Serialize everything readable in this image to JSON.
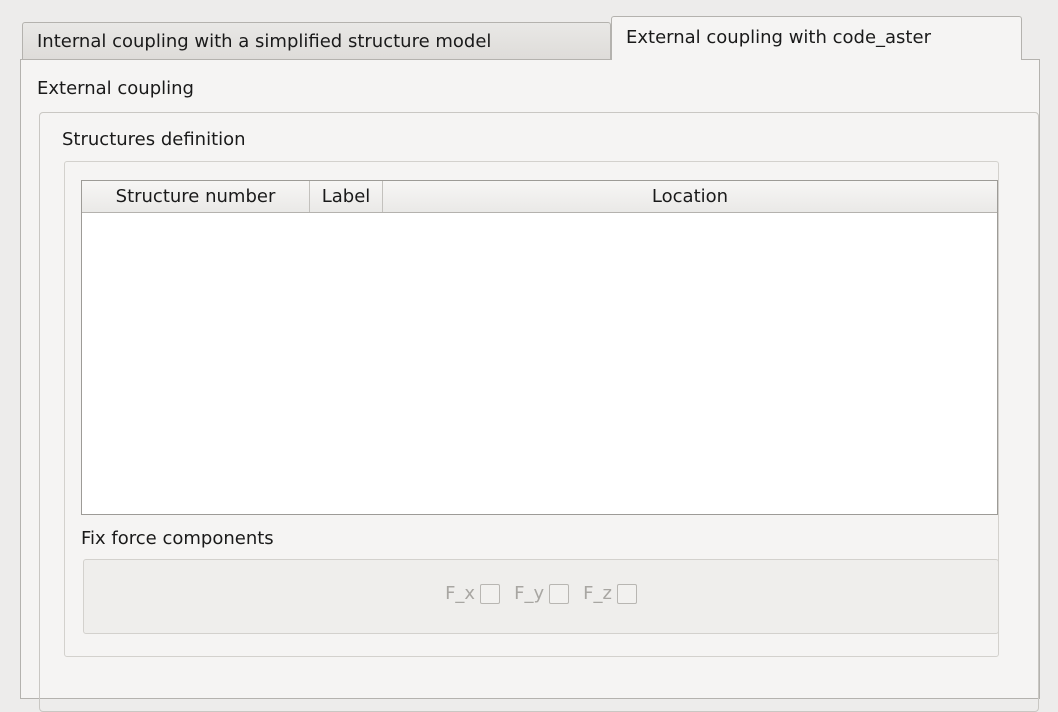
{
  "tabs": [
    {
      "label": "Internal coupling with a simplified structure model",
      "active": false
    },
    {
      "label": "External coupling with code_aster",
      "active": true
    }
  ],
  "pane": {
    "title": "External coupling",
    "structures": {
      "title": "Structures definition",
      "columns": [
        "Structure number",
        "Label",
        "Location"
      ],
      "rows": []
    },
    "fix_force": {
      "title": "Fix force components",
      "components": [
        {
          "label": "F_x",
          "checked": false,
          "enabled": false
        },
        {
          "label": "F_y",
          "checked": false,
          "enabled": false
        },
        {
          "label": "F_z",
          "checked": false,
          "enabled": false
        }
      ]
    }
  }
}
